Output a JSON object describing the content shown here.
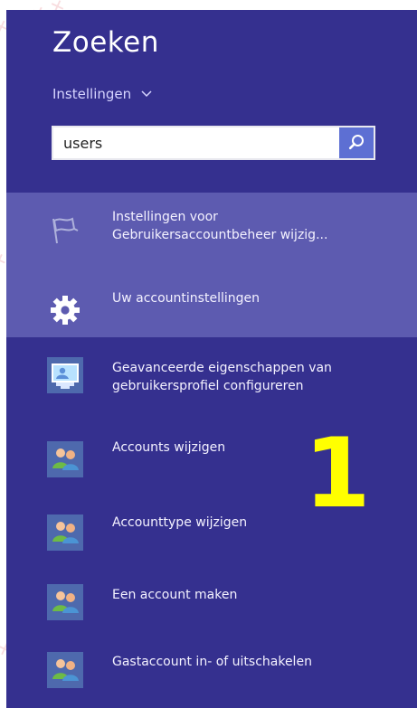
{
  "panel": {
    "title": "Zoeken",
    "scope": "Instellingen",
    "scope_icon": "chevron-down-icon"
  },
  "search": {
    "value": "users",
    "button_icon": "search-icon"
  },
  "results": [
    {
      "line1": "Instellingen voor",
      "line2": "Gebruikersaccountbeheer wijzig...",
      "icon": "flag-icon",
      "selected": true
    },
    {
      "line1": "Uw accountinstellingen",
      "line2": "",
      "icon": "gear-icon",
      "selected": true
    },
    {
      "line1": "Geavanceerde eigenschappen van",
      "line2": "gebruikersprofiel configureren",
      "icon": "computer-profile-icon",
      "selected": false
    },
    {
      "line1": "Accounts wijzigen",
      "line2": "",
      "icon": "users-icon",
      "selected": false
    },
    {
      "line1": "Accounttype wijzigen",
      "line2": "",
      "icon": "users-icon",
      "selected": false
    },
    {
      "line1": "Een account maken",
      "line2": "",
      "icon": "users-icon",
      "selected": false
    },
    {
      "line1": "Gastaccount in- of uitschakelen",
      "line2": "",
      "icon": "users-icon",
      "selected": false
    }
  ],
  "annotation": {
    "number": "1"
  },
  "colors": {
    "panel": "#35308f",
    "selected": "#5d5bb0",
    "search_button": "#5d6fd3",
    "annotation": "#ffff00"
  }
}
